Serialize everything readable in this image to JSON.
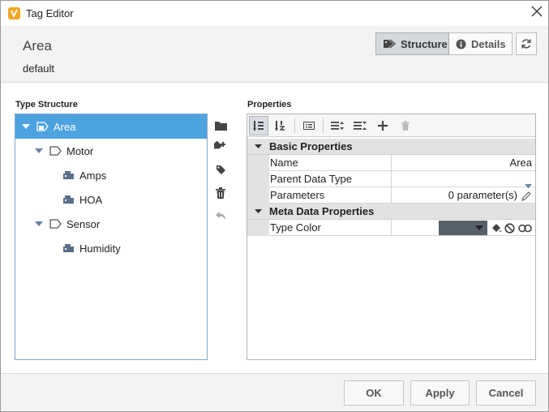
{
  "window": {
    "title": "Tag Editor",
    "close_glyph": "✕"
  },
  "header": {
    "tag_name": "Area",
    "provider": "default"
  },
  "view_toggle": {
    "structure_label": "Structure",
    "details_label": "Details"
  },
  "type_structure": {
    "title": "Type Structure",
    "items": [
      {
        "label": "Area",
        "level": 0,
        "expandable": true,
        "selected": true,
        "icon": "udt-definition-icon"
      },
      {
        "label": "Motor",
        "level": 1,
        "expandable": true,
        "icon": "udt-instance-icon"
      },
      {
        "label": "Amps",
        "level": 2,
        "expandable": false,
        "icon": "memory-tag-icon"
      },
      {
        "label": "HOA",
        "level": 2,
        "expandable": false,
        "icon": "memory-tag-icon"
      },
      {
        "label": "Sensor",
        "level": 1,
        "expandable": true,
        "icon": "udt-instance-icon"
      },
      {
        "label": "Humidity",
        "level": 2,
        "expandable": false,
        "icon": "memory-tag-icon"
      }
    ]
  },
  "side_tools": [
    "folder-icon",
    "add-tag-icon",
    "tag-icon",
    "trash-icon",
    "undo-arrow-icon"
  ],
  "properties": {
    "title": "Properties",
    "categories": [
      {
        "name": "Basic Properties",
        "rows": [
          {
            "name": "Name",
            "value": "Area"
          },
          {
            "name": "Parent Data Type",
            "value": ""
          },
          {
            "name": "Parameters",
            "value": "0 parameter(s)"
          }
        ]
      },
      {
        "name": "Meta Data Properties",
        "rows": [
          {
            "name": "Type Color",
            "value": "",
            "swatch_color": "#55606b"
          }
        ]
      }
    ]
  },
  "footer": {
    "ok_label": "OK",
    "apply_label": "Apply",
    "cancel_label": "Cancel"
  },
  "colors": {
    "selection": "#4da3e0",
    "accent_orange": "#f5a623",
    "swatch": "#55606b"
  }
}
